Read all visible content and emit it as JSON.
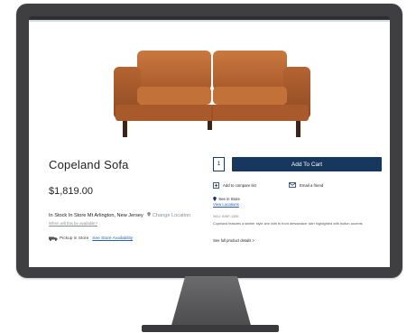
{
  "product": {
    "title": "Copeland Sofa",
    "price": "$1,819.00",
    "sku": "SKU: INSP-1355",
    "description": "Copeland features a shelter style arm with tri front dressmaker skirt highlighted with button accents",
    "full_details_link": "See full product details >"
  },
  "availability": {
    "status": "In Stock In Store Mt Arlington, New Jersey",
    "change_location": "Change Location",
    "when_available": "When will this be available?",
    "pickup_label": "Pickup in Store",
    "store_availability_link": "See Store Availability"
  },
  "cart": {
    "quantity": "1",
    "add_to_cart_label": "Add To Cart"
  },
  "actions": {
    "compare_label": "Add to compare list",
    "email_label": "Email a friend",
    "see_in_store": "See in Store",
    "view_locations": "View Locations"
  },
  "colors": {
    "accent": "#16385f",
    "link": "#2a5ea8",
    "sofa_leather": "#b8693a"
  }
}
